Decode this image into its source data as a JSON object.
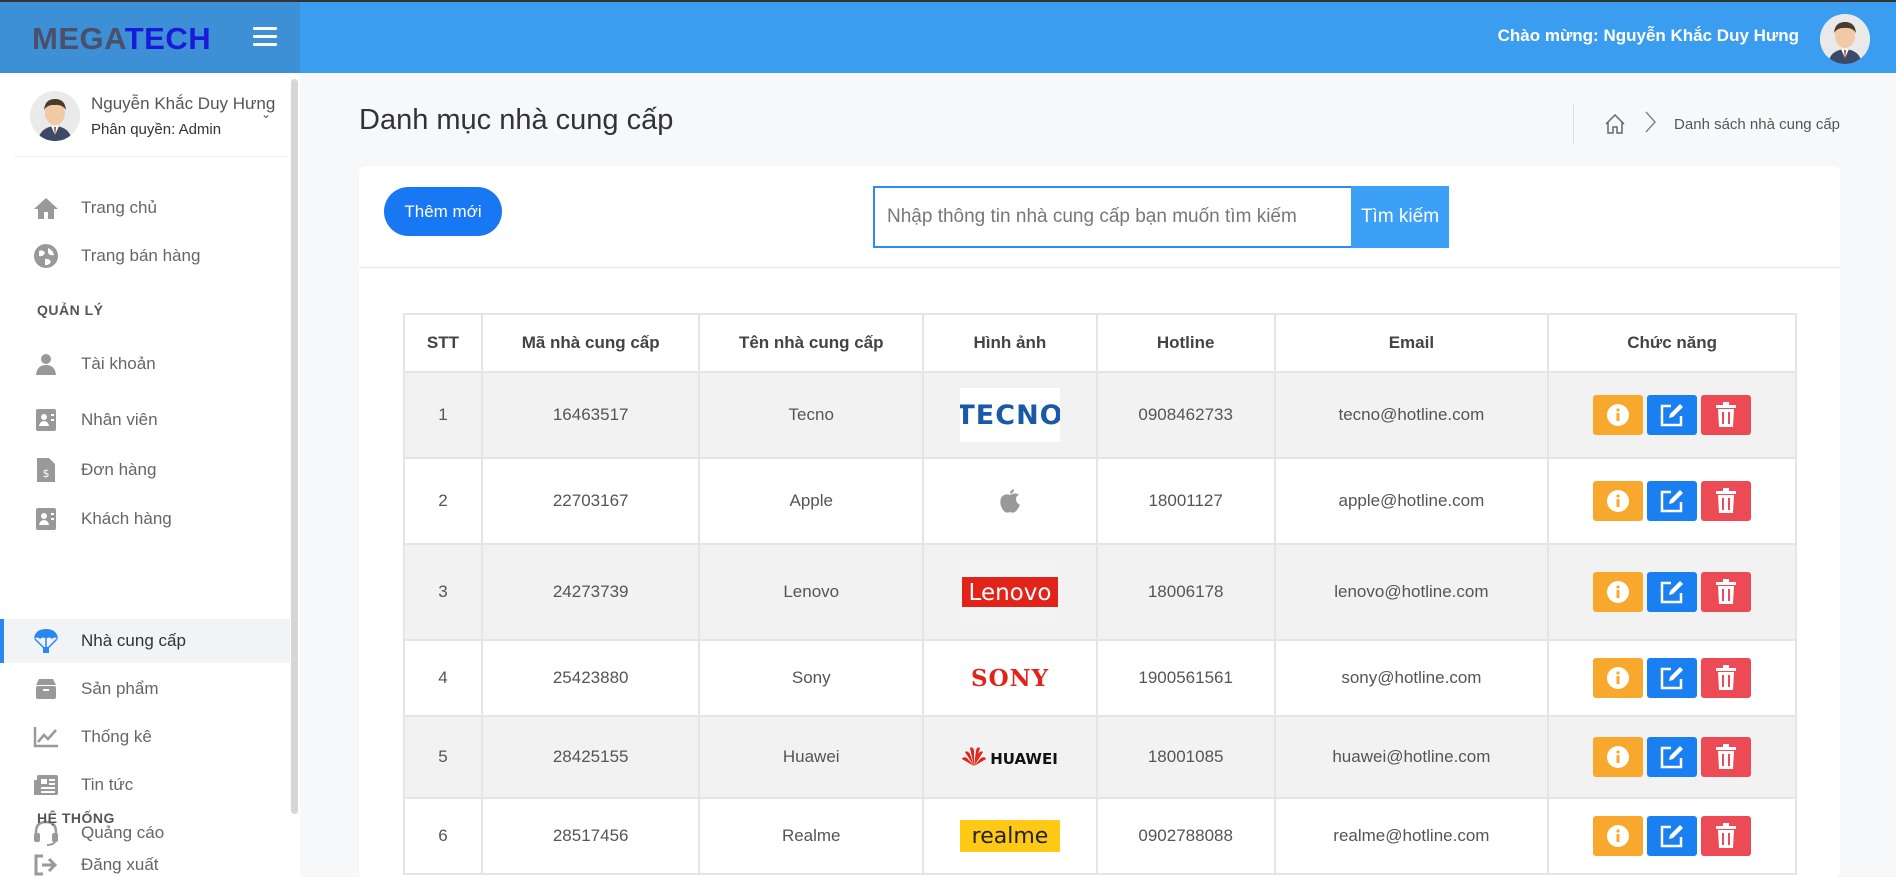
{
  "header": {
    "brand_left": "MEGA",
    "brand_right": "TECH",
    "welcome": "Chào mừng: Nguyễn Khắc Duy Hưng",
    "colors": {
      "topbar": "#3a9df0",
      "brand_bg": "#3d8fd6"
    }
  },
  "sidebar": {
    "user_name": "Nguyễn Khắc Duy Hưng",
    "user_role": "Phân quyền: Admin",
    "items_top": [
      {
        "label": "Trang chủ",
        "icon": "home-icon"
      },
      {
        "label": "Trang bán hàng",
        "icon": "globe-icon"
      }
    ],
    "section_manage": "QUẢN LÝ",
    "items_manage": [
      {
        "label": "Tài khoản",
        "icon": "user-icon"
      },
      {
        "label": "Nhân viên",
        "icon": "contact-card-icon"
      },
      {
        "label": "Đơn hàng",
        "icon": "invoice-icon"
      },
      {
        "label": "Khách hàng",
        "icon": "address-book-icon"
      },
      {
        "label": "Nhà cung cấp",
        "icon": "parachute-icon",
        "active": true
      },
      {
        "label": "Sản phẩm",
        "icon": "box-icon"
      },
      {
        "label": "Thống kê",
        "icon": "line-chart-icon"
      },
      {
        "label": "Tin tức",
        "icon": "newspaper-icon"
      },
      {
        "label": "Quảng cáo",
        "icon": "headset-icon"
      }
    ],
    "section_system": "HỆ THỐNG",
    "items_system": [
      {
        "label": "Đăng xuất",
        "icon": "logout-icon"
      }
    ]
  },
  "main": {
    "page_title": "Danh mục nhà cung cấp",
    "breadcrumb_current": "Danh sách nhà cung cấp",
    "add_button": "Thêm mới",
    "search_placeholder": "Nhập thông tin nhà cung cấp bạn muốn tìm kiếm",
    "search_button": "Tìm kiếm"
  },
  "table": {
    "columns": [
      "STT",
      "Mã nhà cung cấp",
      "Tên nhà cung cấp",
      "Hình ảnh",
      "Hotline",
      "Email",
      "Chức năng"
    ],
    "rows": [
      {
        "stt": "1",
        "code": "16463517",
        "name": "Tecno",
        "logo": "TECNO",
        "hotline": "0908462733",
        "email": "tecno@hotline.com"
      },
      {
        "stt": "2",
        "code": "22703167",
        "name": "Apple",
        "logo": "",
        "hotline": "18001127",
        "email": "apple@hotline.com"
      },
      {
        "stt": "3",
        "code": "24273739",
        "name": "Lenovo",
        "logo": "Lenovo",
        "hotline": "18006178",
        "email": "lenovo@hotline.com"
      },
      {
        "stt": "4",
        "code": "25423880",
        "name": "Sony",
        "logo": "SONY",
        "hotline": "1900561561",
        "email": "sony@hotline.com"
      },
      {
        "stt": "5",
        "code": "28425155",
        "name": "Huawei",
        "logo": "HUAWEI",
        "hotline": "18001085",
        "email": "huawei@hotline.com"
      },
      {
        "stt": "6",
        "code": "28517456",
        "name": "Realme",
        "logo": "realme",
        "hotline": "0902788088",
        "email": "realme@hotline.com"
      }
    ]
  }
}
